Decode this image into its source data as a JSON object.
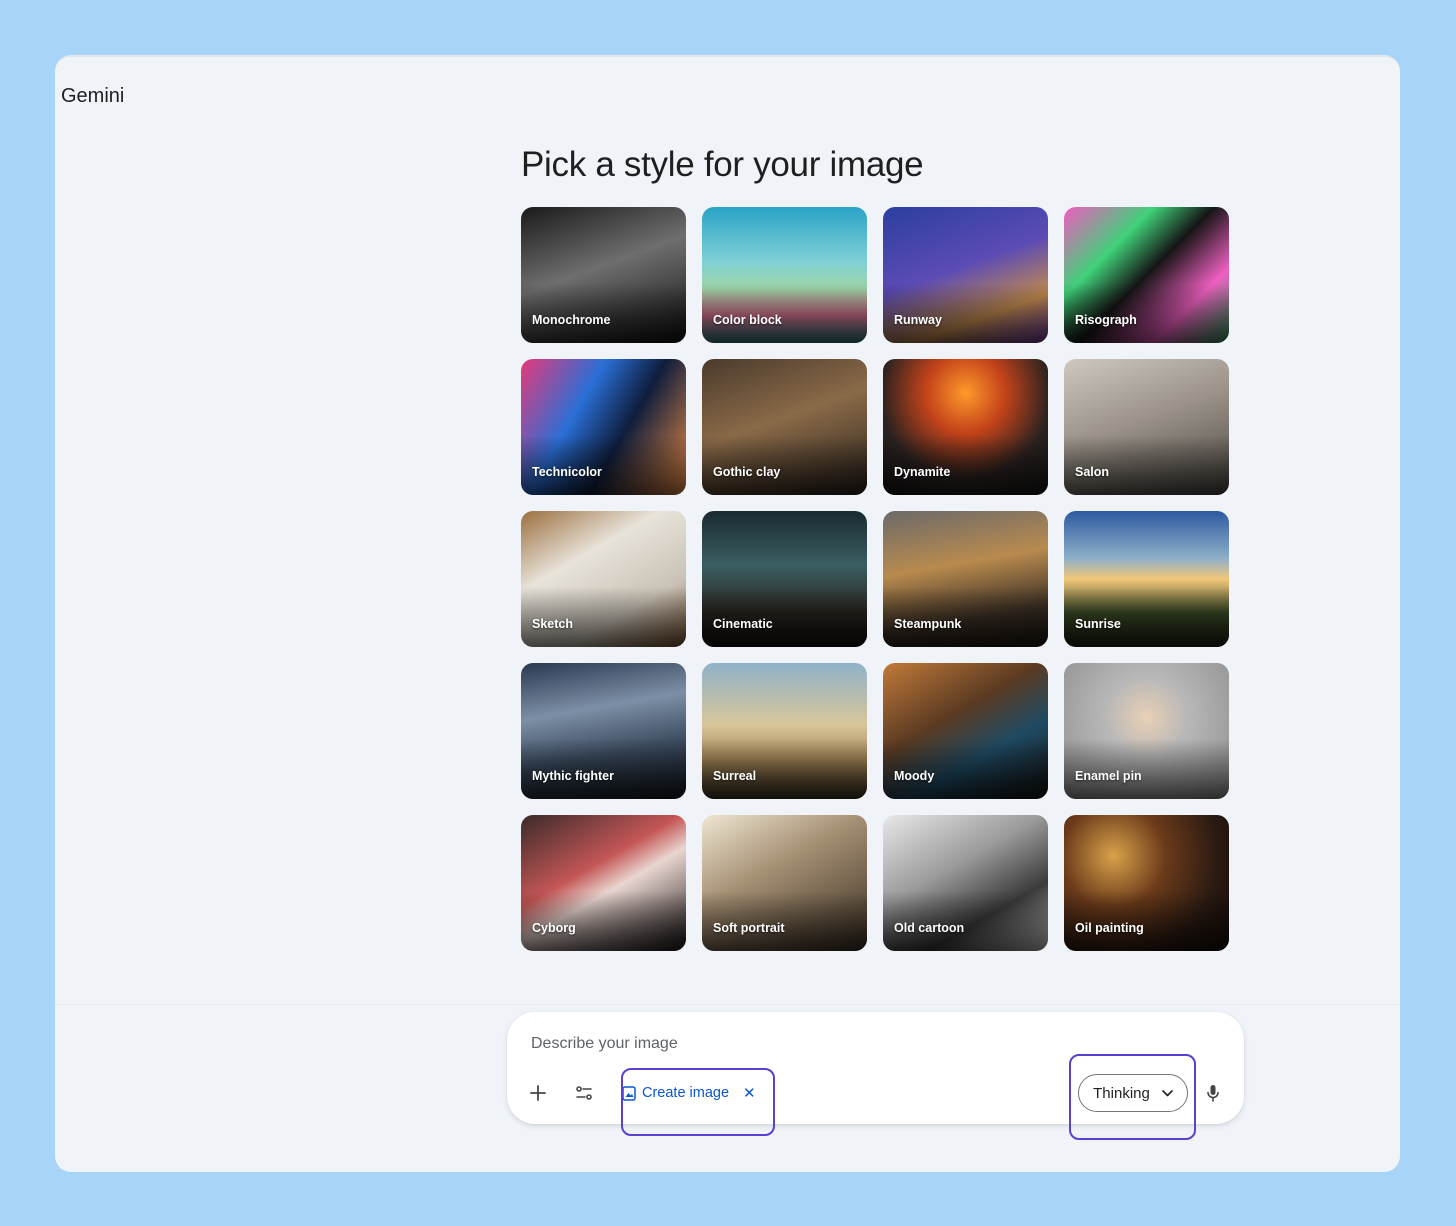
{
  "app": {
    "title": "Gemini"
  },
  "heading": "Pick a style for your image",
  "styles": [
    {
      "label": "Monochrome",
      "art": "linear-gradient(160deg,#1a1a1a 0%,#6e6e6e 45%,#111 100%)"
    },
    {
      "label": "Color block",
      "art": "linear-gradient(180deg,#2aa3c7 0%,#7fd0d5 40%,#9fd6a8 60%,#d56f8c 80%,#2f7f86 100%)"
    },
    {
      "label": "Runway",
      "art": "linear-gradient(160deg,#2b3f9e 0%,#5c4bb5 45%,#c28a4e 75%,#6d3ea0 100%)"
    },
    {
      "label": "Risograph",
      "art": "linear-gradient(135deg,#f05bbf 0%,#3fd17a 30%,#151515 50%,#ee5fc0 75%,#2e9a57 100%)"
    },
    {
      "label": "Technicolor",
      "art": "linear-gradient(120deg,#e6397a 0%,#2a6fd6 35%,#0f1d3c 60%,#f09048 100%)"
    },
    {
      "label": "Gothic clay",
      "art": "linear-gradient(160deg,#4a3a2c 0%,#8a6a48 45%,#2a221c 100%)"
    },
    {
      "label": "Dynamite",
      "art": "radial-gradient(circle at 50% 25%,#ff9a2b 0%,#c4431a 30%,#2a2220 65%,#151515 100%)"
    },
    {
      "label": "Salon",
      "art": "linear-gradient(160deg,#cfc8bf 0%,#9b9389 45%,#4a4540 100%)"
    },
    {
      "label": "Sketch",
      "art": "linear-gradient(150deg,#9b6f3f 0%,#e8e3da 35%,#c9c2b6 70%,#7a5532 100%)"
    },
    {
      "label": "Cinematic",
      "art": "linear-gradient(180deg,#1a2a30 0%,#3b5e63 40%,#2a2620 75%,#100e0c 100%)"
    },
    {
      "label": "Steampunk",
      "art": "linear-gradient(170deg,#6c6a6a 0%,#b88a4e 40%,#3c3025 75%,#1a1510 100%)"
    },
    {
      "label": "Sunrise",
      "art": "linear-gradient(180deg,#2d5aa0 0%,#8fb0c8 35%,#f2c779 50%,#3b4a26 75%,#1c2412 100%)"
    },
    {
      "label": "Mythic fighter",
      "art": "linear-gradient(170deg,#2a3850 0%,#7d8fa6 35%,#3a4a5e 65%,#14181f 100%)"
    },
    {
      "label": "Surreal",
      "art": "linear-gradient(180deg,#8fb2c9 0%,#d9c69b 45%,#a88b5a 70%,#3d3224 100%)"
    },
    {
      "label": "Moody",
      "art": "linear-gradient(150deg,#c27a3a 0%,#5a3a22 40%,#1f4a63 65%,#14110e 100%)"
    },
    {
      "label": "Enamel pin",
      "art": "radial-gradient(circle at 50% 40%,#e9d0b5 0%,#b8b8b8 35%,#8d8d8d 100%)"
    },
    {
      "label": "Cyborg",
      "art": "linear-gradient(150deg,#3b2a2a 0%,#c45656 40%,#e9d6d0 55%,#1a1416 100%)"
    },
    {
      "label": "Soft portrait",
      "art": "linear-gradient(150deg,#efe6d2 0%,#a69074 40%,#3a2e22 100%)"
    },
    {
      "label": "Old cartoon",
      "art": "linear-gradient(150deg,#e8e8e8 0%,#9a9a9a 40%,#3a3a3a 70%,#cfcfcf 100%)"
    },
    {
      "label": "Oil painting",
      "art": "radial-gradient(circle at 30% 30%,#d9a24a 0%,#6a3a1a 35%,#2a1a12 70%,#120c08 100%)"
    }
  ],
  "prompt": {
    "placeholder": "Describe your image",
    "create_chip": "Create image",
    "model_label": "Thinking"
  },
  "highlight_color": "#5b3fd1"
}
